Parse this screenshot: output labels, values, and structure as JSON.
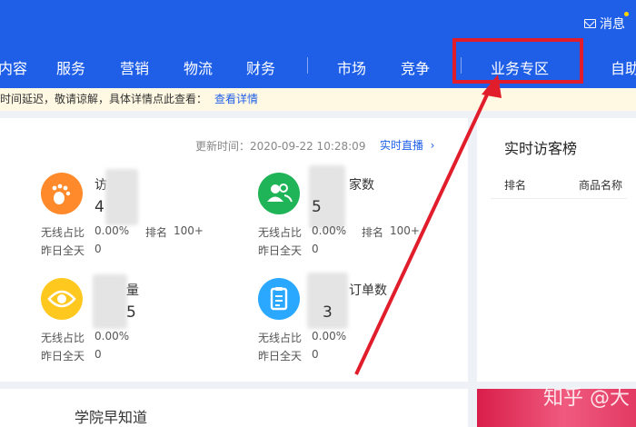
{
  "header": {
    "messages_label": "消息",
    "nav": [
      {
        "label": "内容"
      },
      {
        "label": "服务"
      },
      {
        "label": "营销"
      },
      {
        "label": "物流"
      },
      {
        "label": "财务"
      },
      {
        "label": "市场"
      },
      {
        "label": "竞争"
      },
      {
        "label": "业务专区"
      },
      {
        "label": "自助"
      }
    ]
  },
  "notice": {
    "text": "时间延迟，敬请谅解，具体详情点此查看：",
    "link": "查看详情"
  },
  "dashboard": {
    "update_time": "更新时间：2020-09-22 10:28:09",
    "live_label": "实时直播",
    "metrics": [
      {
        "title_visible": "访",
        "value_visible": "4",
        "wireless_label": "无线占比",
        "wireless_value": "0.00%",
        "rank_label": "排名",
        "rank_value": "100+",
        "yesterday_label": "昨日全天",
        "yesterday_value": "0"
      },
      {
        "title_visible": "家数",
        "value_visible": "5",
        "wireless_label": "无线占比",
        "wireless_value": "0.00%",
        "rank_label": "排名",
        "rank_value": "100+",
        "yesterday_label": "昨日全天",
        "yesterday_value": "0"
      },
      {
        "title_visible": "量",
        "value_visible": "5",
        "wireless_label": "无线占比",
        "wireless_value": "0.00%",
        "yesterday_label": "昨日全天",
        "yesterday_value": "0"
      },
      {
        "title_visible": "订单数",
        "value_visible": "3",
        "wireless_label": "无线占比",
        "wireless_value": "0.00%",
        "yesterday_label": "昨日全天",
        "yesterday_value": "0"
      }
    ]
  },
  "sidebar": {
    "title": "实时访客榜",
    "col_rank": "排名",
    "col_product": "商品名称"
  },
  "bottom": {
    "school_title": "学院早知道"
  },
  "watermark": "知乎 @大",
  "colors": {
    "brand_blue": "#1f5fe8",
    "highlight_red": "#e11d2b"
  }
}
